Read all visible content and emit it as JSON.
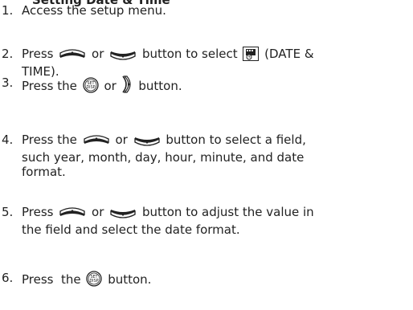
{
  "page": {
    "title_fragment": "Setting Date & Time",
    "steps": [
      {
        "num": "1.",
        "parts": {
          "a": "Access the setup menu."
        }
      },
      {
        "num": "2.",
        "parts": {
          "a": "Press",
          "b": "or",
          "c": "button to select",
          "d": "(DATE &",
          "e": "TIME)."
        }
      },
      {
        "num": "3.",
        "parts": {
          "a": "Press the",
          "b": "or",
          "c": "button."
        }
      },
      {
        "num": "4.",
        "parts": {
          "a": "Press the",
          "b": "or",
          "c": "button to select a field,",
          "d": "such year, month, day, hour, minute, and date",
          "e": "format."
        }
      },
      {
        "num": "5.",
        "parts": {
          "a": "Press",
          "b": "or",
          "c": "button to adjust the value in",
          "d": "the field and select the date format."
        }
      },
      {
        "num": "6.",
        "parts": {
          "a": "Press  the",
          "b": "button."
        }
      }
    ],
    "icons": {
      "up": "up-arrow-button-icon",
      "down": "down-arrow-button-icon",
      "set": "set-disp-button-icon",
      "right": "right-arrow-button-icon",
      "datetime": "date-time-menu-icon",
      "set_label_1": "SET",
      "set_label_2": "DISP"
    }
  }
}
